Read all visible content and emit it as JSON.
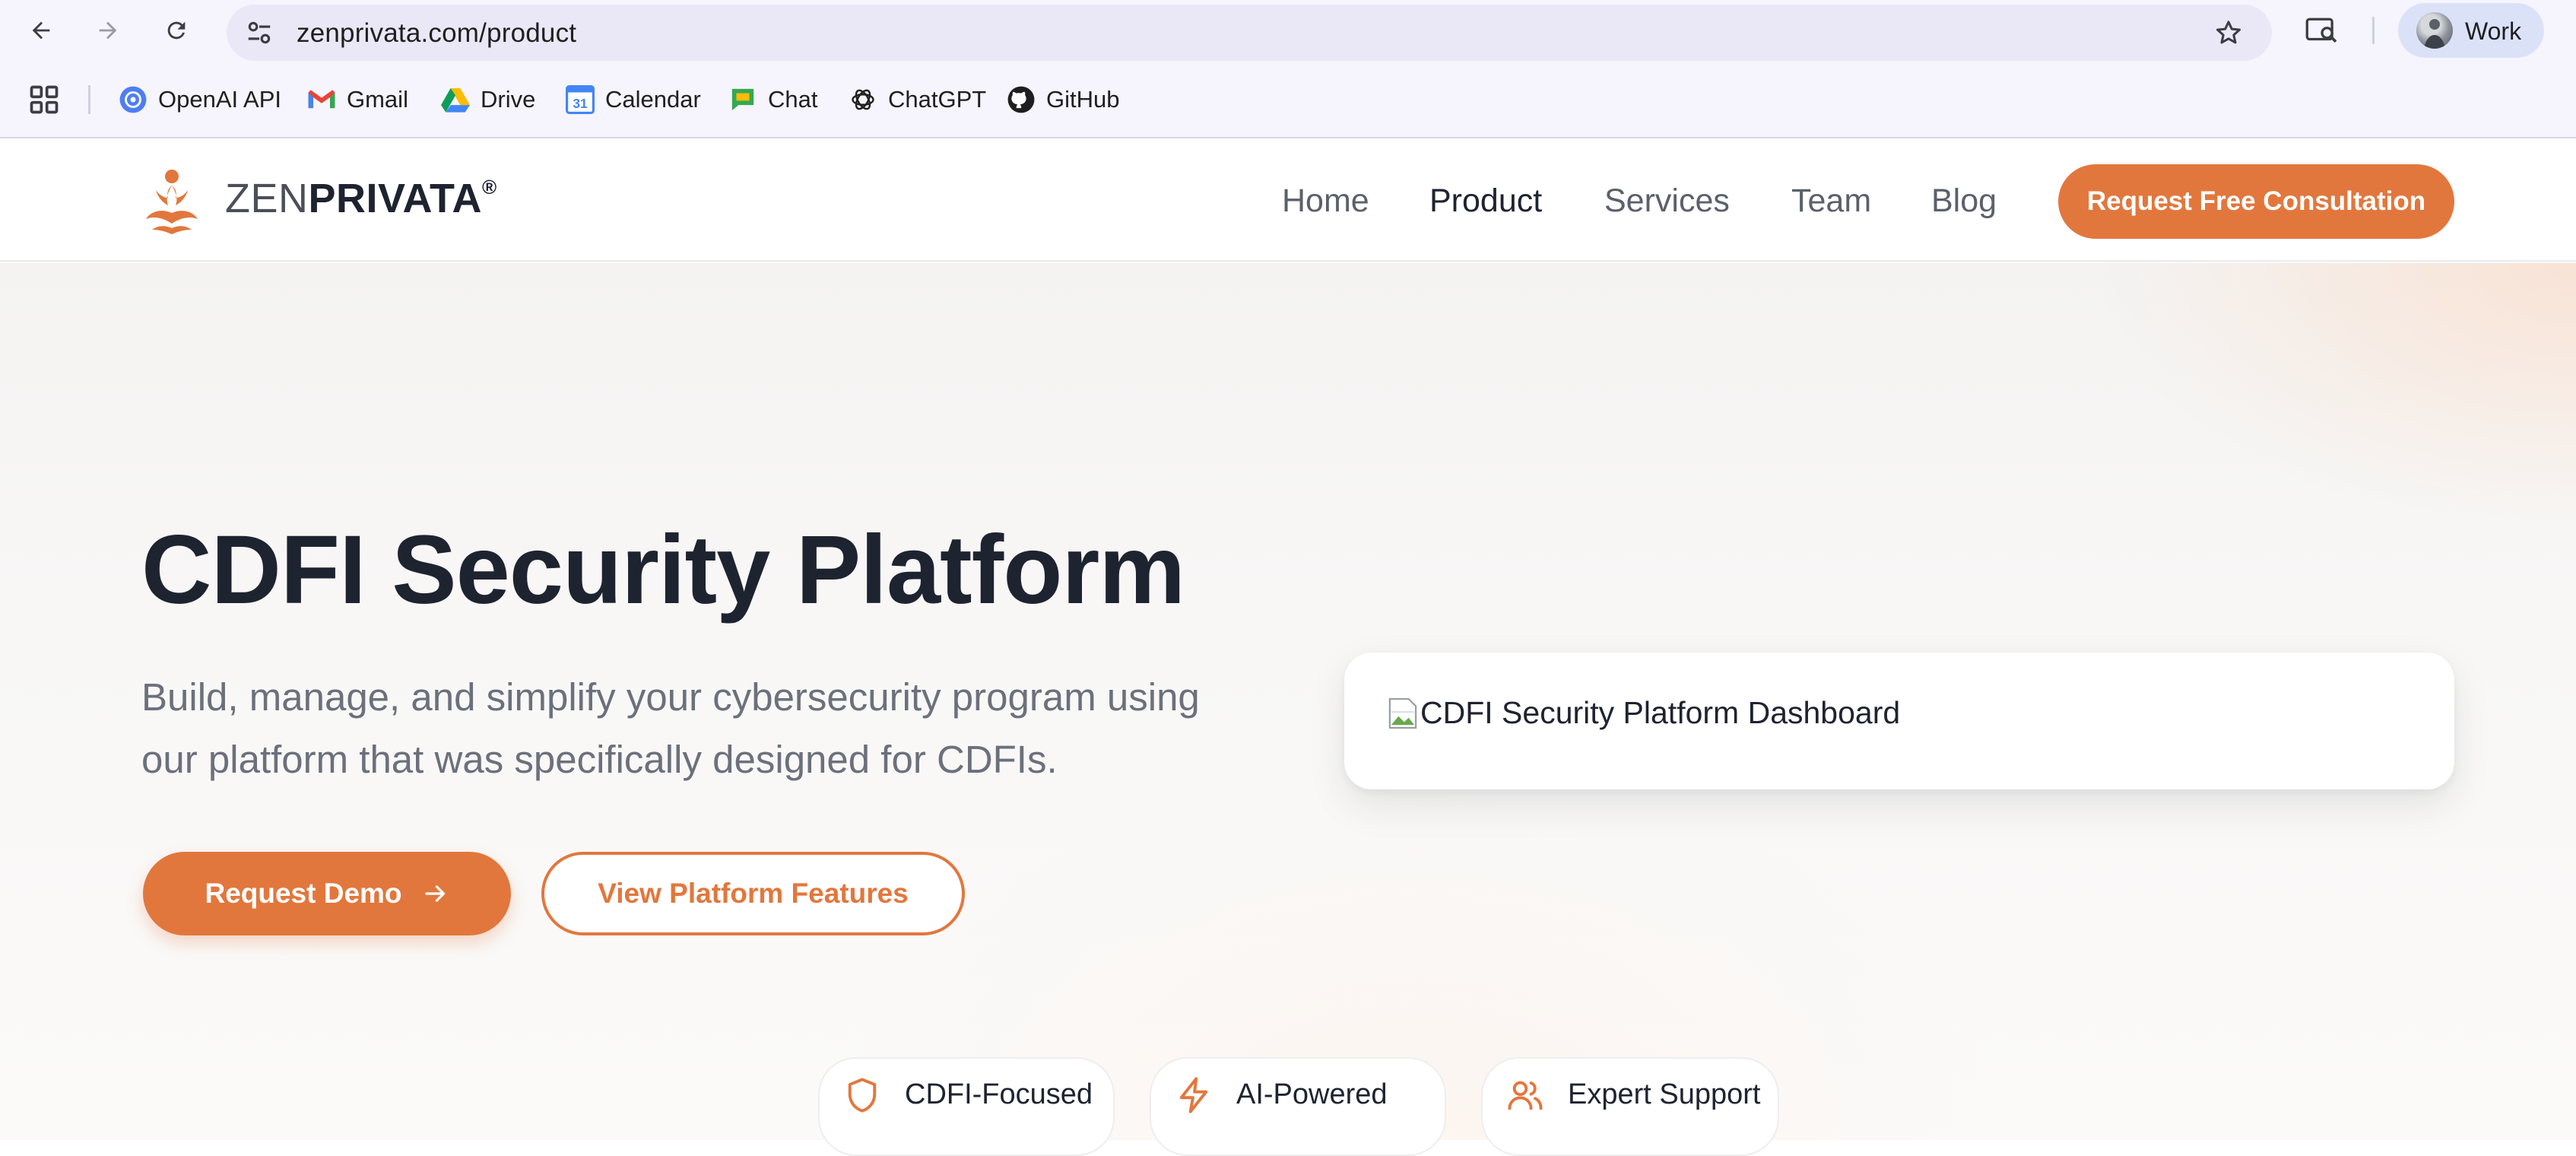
{
  "browser": {
    "url": "zenprivata.com/product",
    "profile_name": "Work",
    "bookmarks": [
      {
        "label": "OpenAI API",
        "icon": "openai-icon"
      },
      {
        "label": "Gmail",
        "icon": "gmail-icon"
      },
      {
        "label": "Drive",
        "icon": "drive-icon"
      },
      {
        "label": "Calendar",
        "icon": "calendar-icon"
      },
      {
        "label": "Chat",
        "icon": "chat-icon"
      },
      {
        "label": "ChatGPT",
        "icon": "chatgpt-icon"
      },
      {
        "label": "GitHub",
        "icon": "github-icon"
      }
    ]
  },
  "site": {
    "brand_light": "ZEN",
    "brand_bold": "PRIVATA",
    "brand_mark": "®",
    "nav": [
      "Home",
      "Product",
      "Services",
      "Team",
      "Blog"
    ],
    "active_nav": "Product",
    "header_cta": "Request Free Consultation"
  },
  "hero": {
    "title": "CDFI Security Platform",
    "subtitle": "Build, manage, and simplify your cybersecurity program using our platform that was specifically designed for CDFIs.",
    "primary_button": "Request Demo",
    "secondary_button": "View Platform Features",
    "dashboard_alt": "CDFI Security Platform Dashboard"
  },
  "features": [
    {
      "label": "CDFI-Focused",
      "icon": "shield-icon"
    },
    {
      "label": "AI-Powered",
      "icon": "lightning-icon"
    },
    {
      "label": "Expert Support",
      "icon": "users-icon"
    }
  ],
  "colors": {
    "accent": "#e2773d",
    "text_dark": "#1e2330",
    "text_muted": "#6b707c"
  }
}
